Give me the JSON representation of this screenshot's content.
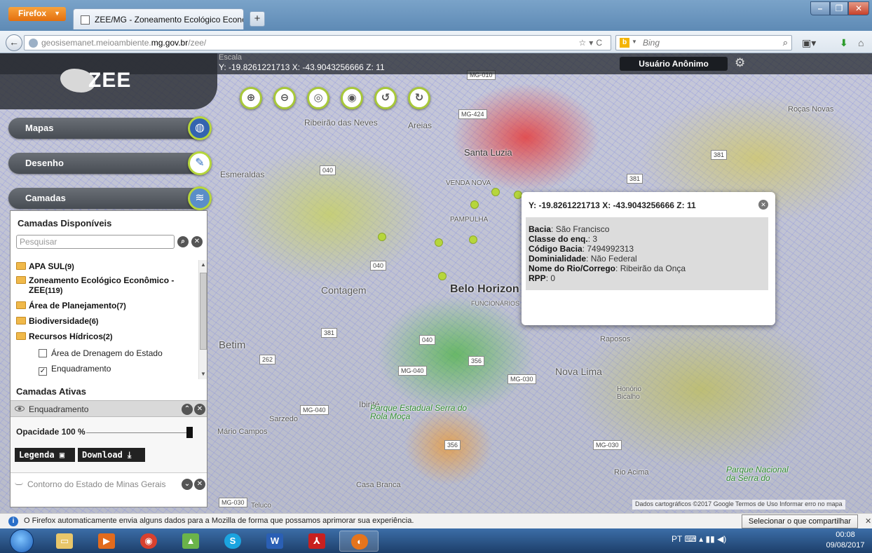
{
  "browser": {
    "menu_label": "Firefox",
    "tab_title": "ZEE/MG - Zoneamento Ecológico Econô...",
    "url_prefix": "geosisemanet.meioambiente.",
    "url_domain": "mg.gov.br",
    "url_suffix": "/zee/",
    "search_placeholder": "Bing"
  },
  "header": {
    "scale_label": "Escala",
    "coords": "Y: -19.8261221713  X: -43.9043256666  Z: 11",
    "user": "Usuário Anônimo"
  },
  "logo": {
    "text": "ZEE"
  },
  "sidebar": {
    "sections": [
      {
        "label": "Mapas"
      },
      {
        "label": "Desenho"
      },
      {
        "label": "Camadas"
      }
    ],
    "available_title": "Camadas Disponíveis",
    "search_placeholder": "Pesquisar",
    "tree": [
      {
        "label": "APA SUL",
        "count": "(9)"
      },
      {
        "label": "Zoneamento Ecológico Econômico -",
        "label2": "ZEE",
        "count": "(119)"
      },
      {
        "label": "Área de Planejamento",
        "count": "(7)"
      },
      {
        "label": "Biodiversidade",
        "count": "(6)"
      },
      {
        "label": "Recursos Hídricos",
        "count": "(2)"
      }
    ],
    "sub_items": [
      {
        "label": "Área de Drenagem do Estado",
        "checked": false
      },
      {
        "label": "Enquadramento",
        "checked": true
      }
    ],
    "active_title": "Camadas Ativas",
    "active_layer": "Enquadramento",
    "opacity_label": "Opacidade 100 %",
    "opacity_value": 1.0,
    "legend_label": "Legenda",
    "download_label": "Download",
    "contour_layer": "Contorno do Estado de Minas Gerais"
  },
  "popup": {
    "head": "Y: -19.8261221713 X: -43.9043256666 Z: 11",
    "rows": [
      {
        "key": "Bacia",
        "value": "São Francisco"
      },
      {
        "key": "Classe do enq.",
        "value": "3"
      },
      {
        "key": "Código Bacia",
        "value": "7494992313"
      },
      {
        "key": "Dominialidade",
        "value": "Não Federal"
      },
      {
        "key": "Nome do Rio/Corrego",
        "value": "Ribeirão da Onça"
      },
      {
        "key": "RPP",
        "value": "0"
      }
    ]
  },
  "map": {
    "labels": {
      "ribeirao": "Ribeirão das Neves",
      "areias": "Areias",
      "santa_luzia": "Santa Luzia",
      "esmeraldas": "Esmeraldas",
      "venda_nova": "VENDA NOVA",
      "pampulha": "PAMPULHA",
      "contagem": "Contagem",
      "belo_horizonte": "Belo Horizon",
      "funcionarios": "FUNCIONÁRIOS",
      "betim": "Betim",
      "nova_lima": "Nova Lima",
      "raposos": "Raposos",
      "honorio": "Honório Bicalho",
      "ibirite": "Ibirité",
      "sarzedo": "Sarzedo",
      "mario_campos": "Mário Campos",
      "parque_rola": "Parque Estadual Serra do Rola Moça",
      "casa_branca": "Casa Branca",
      "rio_acima": "Rio Acima",
      "parque_serrado": "Parque Nacional da Serra do",
      "rocas_novas": "Roças Novas",
      "teluco": "Teluco"
    },
    "roads": [
      "MG-010",
      "MG-424",
      "040",
      "381",
      "040",
      "381",
      "040",
      "356",
      "MG-040",
      "MG-030",
      "356",
      "MG-030",
      "MG-040",
      "262",
      "381",
      "MG-030"
    ],
    "attribution": "Dados cartográficos ©2017 Google   Termos de Uso   Informar erro no mapa"
  },
  "notification": {
    "text": "O Firefox automaticamente envia alguns dados para a Mozilla de forma que possamos aprimorar sua experiência.",
    "button": "Selecionar o que compartilhar"
  },
  "taskbar": {
    "lang": "PT",
    "time": "00:08",
    "date": "09/08/2017"
  }
}
